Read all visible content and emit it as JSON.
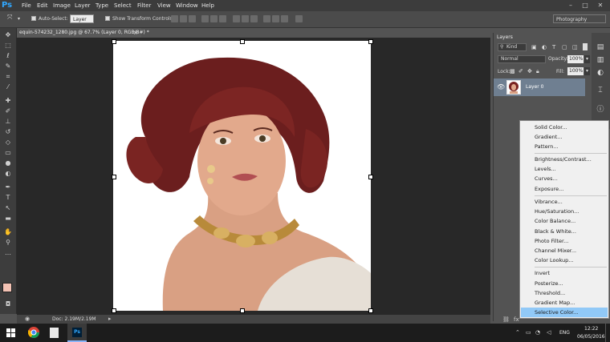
{
  "app": {
    "logo": "Ps"
  },
  "menu": [
    "File",
    "Edit",
    "Image",
    "Layer",
    "Type",
    "Select",
    "Filter",
    "View",
    "Window",
    "Help"
  ],
  "window_controls": {
    "minimize": "–",
    "maximize": "□",
    "close": "✕"
  },
  "options": {
    "auto_select_label": "Auto-Select:",
    "auto_select_target": "Layer",
    "show_transform_label": "Show Transform Controls",
    "workspace": "Photography"
  },
  "document": {
    "tab_title": "equin-574232_1280.jpg @ 67.7% (Layer 0, RGB/8#) *",
    "tab_close": "×",
    "doc_size": "Doc: 2.19M/2.19M"
  },
  "layers": {
    "tab_label": "Layers",
    "filter_kind": "Kind",
    "blend_mode": "Normal",
    "opacity_label": "Opacity:",
    "opacity_value": "100%",
    "lock_label": "Lock:",
    "fill_label": "Fill:",
    "fill_value": "100%",
    "layer_name": "Layer 0"
  },
  "adjustment_menu": {
    "group1": [
      "Solid Color...",
      "Gradient...",
      "Pattern..."
    ],
    "group2": [
      "Brightness/Contrast...",
      "Levels...",
      "Curves...",
      "Exposure..."
    ],
    "group3": [
      "Vibrance...",
      "Hue/Saturation...",
      "Color Balance...",
      "Black & White...",
      "Photo Filter...",
      "Channel Mixer...",
      "Color Lookup..."
    ],
    "group4": [
      "Invert",
      "Posterize...",
      "Threshold...",
      "Gradient Map...",
      "Selective Color..."
    ],
    "highlighted": "Selective Color..."
  },
  "taskbar": {
    "language": "ENG",
    "time": "12:22",
    "date": "06/05/2016"
  },
  "colors": {
    "foreground": "#f3c2b4",
    "background": "#ffffff",
    "menu_highlight": "#91c9f7"
  }
}
